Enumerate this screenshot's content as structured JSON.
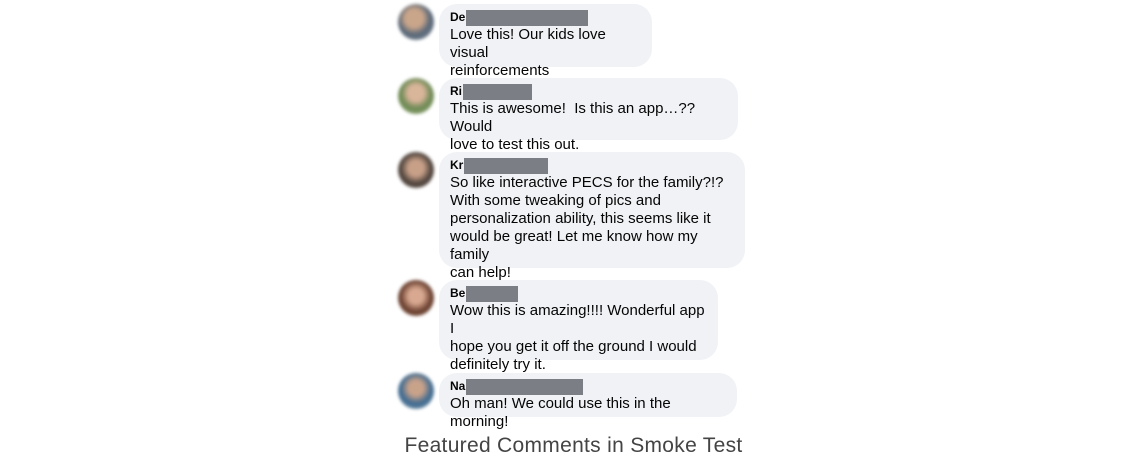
{
  "comments": [
    {
      "name": "De",
      "text": "Love this! Our kids love visual\nreinforcements",
      "avatar_color": "#6f7b8a"
    },
    {
      "name": "Ri",
      "text": "This is awesome!  Is this an app…?? Would\nlove to test this out.",
      "avatar_color": "#7f8f6a"
    },
    {
      "name": "Kr",
      "text": "So like interactive PECS for the family?!?\nWith some tweaking of pics and\npersonalization ability, this seems like it\nwould be great! Let me know how my family\ncan help!",
      "avatar_color": "#6b5e55"
    },
    {
      "name": "Be",
      "text": "Wow this is amazing!!!! Wonderful app I\nhope you get it off the ground I would\ndefinitely try it.",
      "avatar_color": "#8a6a55"
    },
    {
      "name": "Na",
      "text": "Oh man! We could use this in the morning!",
      "avatar_color": "#5f7f9a"
    }
  ],
  "caption": "Featured Comments in Smoke Test",
  "colors": {
    "bubble": "#f0f2f5",
    "redaction": "#7b7e84",
    "text": "#050505",
    "caption": "#444444"
  }
}
